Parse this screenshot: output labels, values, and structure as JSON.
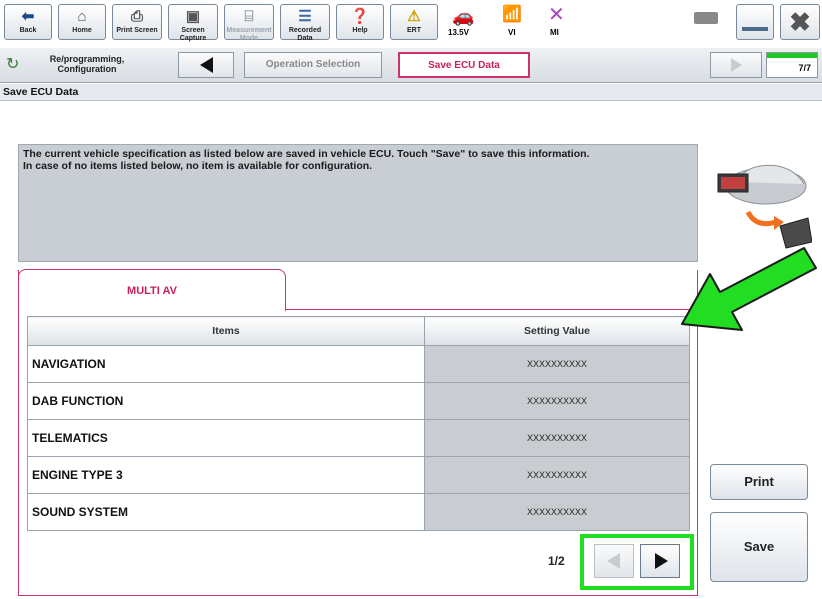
{
  "toolbar": {
    "back": "Back",
    "home": "Home",
    "print_screen": "Print Screen",
    "screen_capture": "Screen Capture",
    "measurement_mode": "Measurement Mode",
    "recorded_data": "Recorded Data",
    "help": "Help",
    "ert": "ERT",
    "voltage": "13.5V",
    "vi": "VI",
    "mi": "MI"
  },
  "nav": {
    "reprogramming": "Re/programming, Configuration",
    "operation_selection": "Operation Selection",
    "save_ecu_data": "Save ECU Data",
    "step": "7/7"
  },
  "page_title": "Save ECU Data",
  "info_text": "The current vehicle specification as listed below are saved in vehicle ECU. Touch \"Save\" to save this information.\nIn case of no items listed below, no item is available for configuration.",
  "tab": {
    "label": "MULTI AV"
  },
  "table": {
    "headers": [
      "Items",
      "Setting Value"
    ],
    "rows": [
      {
        "item": "NAVIGATION",
        "value": "XXXXXXXXXX"
      },
      {
        "item": "DAB FUNCTION",
        "value": "XXXXXXXXXX"
      },
      {
        "item": "TELEMATICS",
        "value": "XXXXXXXXXX"
      },
      {
        "item": "ENGINE TYPE 3",
        "value": "XXXXXXXXXX"
      },
      {
        "item": "SOUND SYSTEM",
        "value": "XXXXXXXXXX"
      }
    ]
  },
  "pagination": {
    "label": "1/2"
  },
  "buttons": {
    "print": "Print",
    "save": "Save"
  },
  "colors": {
    "accent": "#cc3366",
    "highlight": "#22dd22"
  },
  "icons": [
    "back-arrow-icon",
    "home-icon",
    "printer-icon",
    "camera-icon",
    "measurement-icon",
    "recorded-data-icon",
    "help-icon",
    "warning-icon",
    "car-icon",
    "signal-icon",
    "close-x-icon",
    "battery-icon",
    "minimize-icon",
    "close-window-icon",
    "car-to-laptop-icon",
    "triangle-left-icon",
    "triangle-right-icon"
  ]
}
